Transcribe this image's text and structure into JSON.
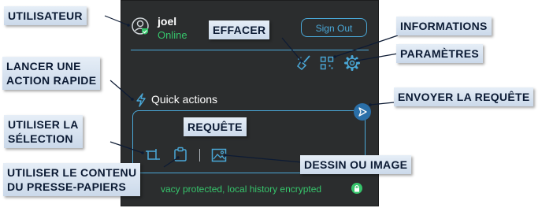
{
  "user": {
    "name": "joel",
    "status": "Online"
  },
  "signout_label": "Sign Out",
  "quick_actions_label": "Quick actions",
  "footer_text": "vacy protected, local history encrypted",
  "colors": {
    "accent": "#4aa8d8",
    "online": "#36c46b",
    "panel": "#2b2d2e"
  },
  "icons": {
    "user": "user-check-icon",
    "clear": "broom-icon",
    "info": "qr-grid-icon",
    "settings": "gear-icon",
    "quick": "lightning-icon",
    "send": "send-icon",
    "selection": "crop-icon",
    "clipboard": "clipboard-icon",
    "image": "image-icon",
    "lock": "lock-icon"
  },
  "callouts": {
    "user": "UTILISATEUR",
    "clear": "EFFACER",
    "info": "INFORMATIONS",
    "settings": "PARAMÈTRES",
    "quick_l1": "LANCER UNE",
    "quick_l2": "ACTION RAPIDE",
    "send": "ENVOYER LA REQUÊTE",
    "request": "REQUÊTE",
    "selection_l1": "UTILISER LA",
    "selection_l2": "SÉLECTION",
    "clipboard_l1": "UTILISER LE CONTENU",
    "clipboard_l2": "DU PRESSE-PAPIERS",
    "drawing": "DESSIN OU IMAGE"
  }
}
